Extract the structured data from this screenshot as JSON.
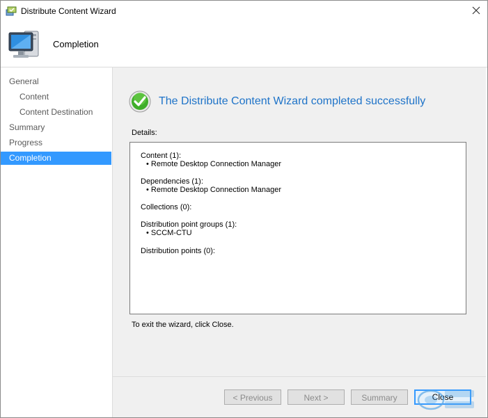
{
  "window": {
    "title": "Distribute Content Wizard",
    "header_title": "Completion"
  },
  "sidebar": {
    "items": [
      {
        "label": "General",
        "level": 0,
        "active": false
      },
      {
        "label": "Content",
        "level": 1,
        "active": false
      },
      {
        "label": "Content Destination",
        "level": 1,
        "active": false
      },
      {
        "label": "Summary",
        "level": 0,
        "active": false
      },
      {
        "label": "Progress",
        "level": 0,
        "active": false
      },
      {
        "label": "Completion",
        "level": 0,
        "active": true
      }
    ]
  },
  "main": {
    "success_message": "The Distribute Content Wizard completed successfully",
    "details_label": "Details:",
    "details": {
      "content_heading": "Content (1):",
      "content_item": "Remote Desktop Connection Manager",
      "dependencies_heading": "Dependencies (1):",
      "dependencies_item": "Remote Desktop Connection Manager",
      "collections_heading": "Collections (0):",
      "dp_groups_heading": "Distribution point groups (1):",
      "dp_groups_item": "SCCM-CTU",
      "dp_heading": "Distribution points (0):"
    },
    "exit_instruction": "To exit the wizard, click Close."
  },
  "footer": {
    "previous_label": "< Previous",
    "next_label": "Next >",
    "summary_label": "Summary",
    "close_label": "Close"
  },
  "colors": {
    "accent": "#3399ff",
    "success_text": "#1e73c8",
    "panel_bg": "#f0f0f0"
  },
  "icons": {
    "app": "wizard-app-icon",
    "header": "computer-monitor-icon",
    "success": "green-checkmark-icon",
    "close": "close-icon"
  }
}
